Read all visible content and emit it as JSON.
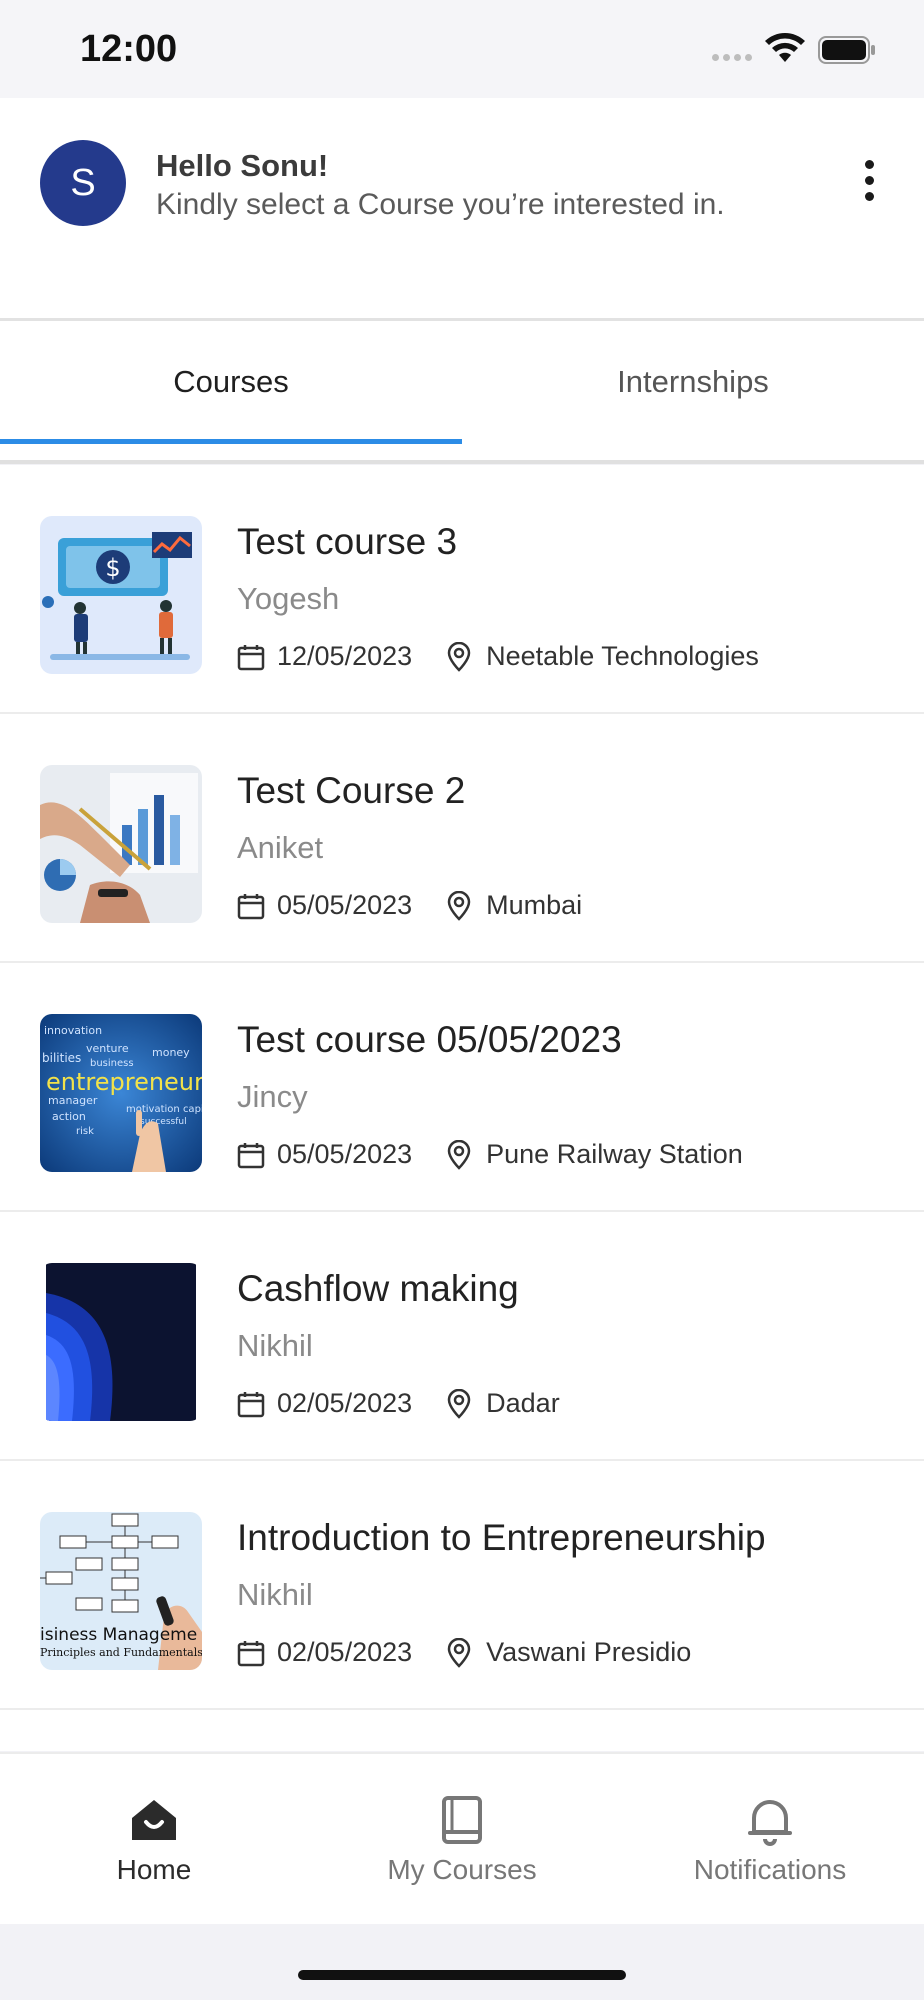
{
  "status_bar": {
    "time": "12:00"
  },
  "header": {
    "avatar_initial": "S",
    "greeting": "Hello Sonu!",
    "subtitle": "Kindly select a Course you’re interested in."
  },
  "tabs": [
    {
      "label": "Courses",
      "active": true
    },
    {
      "label": "Internships",
      "active": false
    }
  ],
  "courses": [
    {
      "title": "Test course 3",
      "instructor": "Yogesh",
      "date": "12/05/2023",
      "location": "Neetable Technologies",
      "thumbnail": "finance-illustration"
    },
    {
      "title": "Test Course 2",
      "instructor": "Aniket",
      "date": "05/05/2023",
      "location": "Mumbai",
      "thumbnail": "charts-photo"
    },
    {
      "title": "Test course 05/05/2023",
      "instructor": "Jincy",
      "date": "05/05/2023",
      "location": "Pune Railway Station",
      "thumbnail": "entrepreneur-wordcloud"
    },
    {
      "title": "Cashflow making",
      "instructor": "Nikhil",
      "date": "02/05/2023",
      "location": "Dadar",
      "thumbnail": "blue-abstract"
    },
    {
      "title": "Introduction to Entrepreneurship",
      "instructor": "Nikhil",
      "date": "02/05/2023",
      "location": "Vaswani Presidio",
      "thumbnail": "business-management-flowchart"
    }
  ],
  "bottom_nav": [
    {
      "label": "Home",
      "icon": "home-icon",
      "active": true
    },
    {
      "label": "My Courses",
      "icon": "book-icon",
      "active": false
    },
    {
      "label": "Notifications",
      "icon": "bell-icon",
      "active": false
    }
  ],
  "colors": {
    "accent": "#2c8ce6",
    "avatar_bg": "#243a8c"
  }
}
